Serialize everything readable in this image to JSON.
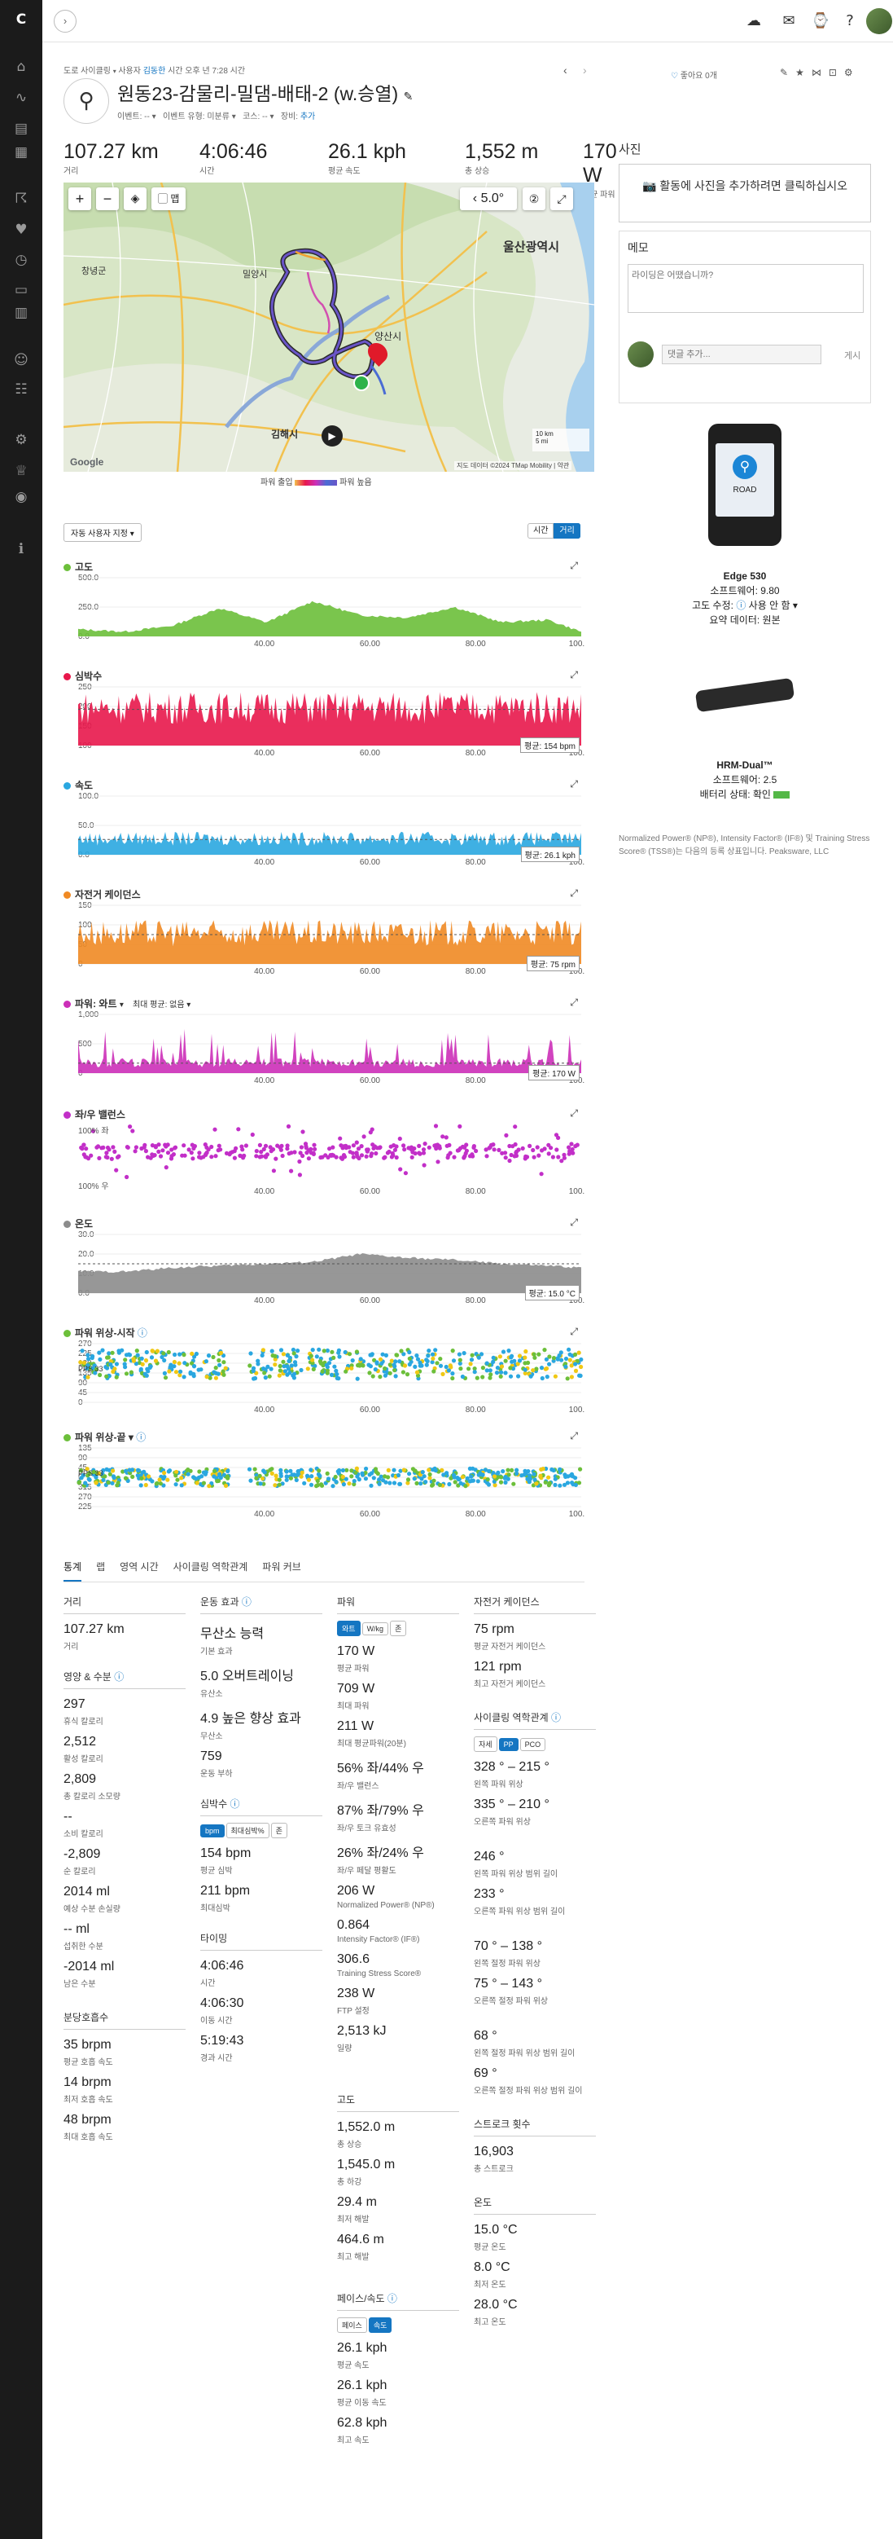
{
  "breadcrumb": {
    "category": "도로 사이클링",
    "by_prefix": "사용자",
    "user": "김동한",
    "date": "시간 오후 년 7:28 시간"
  },
  "activity": {
    "title": "원동23-감물리-밀댐-배태-2 (w.승열)",
    "like": "좋아요 0개",
    "meta": {
      "event_label": "이벤트:",
      "event_value": "--",
      "event_type_label": "이벤트 유형:",
      "event_type_value": "미분류",
      "course_label": "코스:",
      "course_value": "--",
      "gear_label": "장비:",
      "gear_value": "추가"
    }
  },
  "stats": [
    {
      "value": "107.27 km",
      "label": "거리"
    },
    {
      "value": "4:06:46",
      "label": "시간"
    },
    {
      "value": "26.1 kph",
      "label": "평균 속도"
    },
    {
      "value": "1,552 m",
      "label": "총 상승"
    },
    {
      "value": "170 W",
      "label": "평균 파워"
    }
  ],
  "map": {
    "weather": "5.0°",
    "city_ulsan": "울산광역시",
    "city_gimhae": "김해시",
    "city_yangsan": "양산시",
    "city_miryang": "밀양시",
    "city_changnyeong": "창녕군",
    "scale_km": "10 km",
    "scale_mi": "5 mi",
    "copyright": "지도 데이터 ©2024 TMap Mobility",
    "terms": "약관",
    "brand": "Google",
    "legend_left": "파워 출입",
    "legend_right": "파워 높음",
    "layers_label": "맵"
  },
  "chart_controls": {
    "zoom_select": "자동 사용자 지정",
    "toggle_time": "시간",
    "toggle_distance": "거리"
  },
  "charts": {
    "elevation": {
      "title": "고도"
    },
    "heart_rate": {
      "title": "심박수",
      "avg": "평균: 154 bpm"
    },
    "speed": {
      "title": "속도",
      "avg": "평균: 26.1 kph"
    },
    "cadence": {
      "title": "자전거 케이던스",
      "avg": "평균: 75 rpm"
    },
    "power": {
      "title": "파워: 와트",
      "max_avg": "최대 평균: 없음",
      "avg": "평균: 170 W"
    },
    "balance": {
      "title": "좌/우 밸런스",
      "label_top": "100% 좌",
      "label_bottom": "100% 우"
    },
    "temperature": {
      "title": "온도",
      "avg": "평균: 15.0 °C"
    },
    "power_phase_start": {
      "title": "파워 위상-시작",
      "pps_label": "PPS 33"
    },
    "power_phase_end": {
      "title": "파워 위상-끝",
      "pps_label": "PPS 33"
    }
  },
  "chart_data": [
    {
      "type": "area",
      "title": "고도",
      "x": [
        0,
        10,
        20,
        30,
        40,
        50,
        60,
        70,
        80,
        90,
        100,
        107
      ],
      "values": [
        60,
        40,
        90,
        240,
        120,
        300,
        180,
        160,
        250,
        120,
        140,
        40
      ],
      "ylim": [
        0,
        500
      ],
      "y_ticks": [
        "500.0",
        "250.0",
        "0.0"
      ],
      "x_ticks": [
        "40.00",
        "60.00",
        "80.00",
        "100.00"
      ]
    },
    {
      "type": "area",
      "title": "심박수",
      "ylim": [
        0,
        250
      ],
      "y_ticks": [
        "250",
        "200",
        "150",
        "100"
      ],
      "x_ticks": [
        "40.00",
        "60.00",
        "80.00",
        "100.00"
      ],
      "avg": 154
    },
    {
      "type": "area",
      "title": "속도",
      "ylim": [
        0,
        100
      ],
      "y_ticks": [
        "100.0",
        "50.0",
        "0.0"
      ],
      "x_ticks": [
        "40.00",
        "60.00",
        "80.00",
        "100.00"
      ],
      "avg": 26.1
    },
    {
      "type": "area",
      "title": "자전거 케이던스",
      "ylim": [
        0,
        150
      ],
      "y_ticks": [
        "150",
        "100",
        "50",
        "0"
      ],
      "x_ticks": [
        "40.00",
        "60.00",
        "80.00",
        "100.00"
      ],
      "avg": 75
    },
    {
      "type": "area",
      "title": "파워: 와트",
      "ylim": [
        0,
        1000
      ],
      "y_ticks": [
        "1,000",
        "500",
        "0"
      ],
      "x_ticks": [
        "40.00",
        "60.00",
        "80.00",
        "100.00"
      ],
      "avg": 170
    },
    {
      "type": "scatter",
      "title": "좌/우 밸런스",
      "ylim": [
        -100,
        100
      ],
      "x_ticks": [
        "40.00",
        "60.00",
        "80.00",
        "100.00"
      ]
    },
    {
      "type": "area",
      "title": "온도",
      "x": [
        0,
        10,
        20,
        30,
        40,
        50,
        60,
        70,
        80,
        90,
        100,
        107
      ],
      "values": [
        11,
        11,
        13,
        14,
        15,
        16,
        20,
        18,
        17,
        15,
        14,
        13
      ],
      "ylim": [
        0,
        30
      ],
      "y_ticks": [
        "30.0",
        "20.0",
        "10.0",
        "0.0"
      ],
      "x_ticks": [
        "40.00",
        "60.00",
        "80.00",
        "100.00"
      ],
      "avg": 15.0
    },
    {
      "type": "scatter",
      "title": "파워 위상-시작",
      "y_ticks": [
        "270",
        "225",
        "180",
        "135",
        "90",
        "45",
        "0"
      ],
      "x_ticks": [
        "40.00",
        "60.00",
        "80.00",
        "100.00"
      ]
    },
    {
      "type": "scatter",
      "title": "파워 위상-끝",
      "y_ticks": [
        "135",
        "90",
        "45",
        "0",
        "315",
        "270",
        "225"
      ],
      "x_ticks": [
        "40.00",
        "60.00",
        "80.00",
        "100.00"
      ]
    }
  ],
  "tabs": [
    "통계",
    "랩",
    "영역 시간",
    "사이클링 역학관계",
    "파워 커브"
  ],
  "summary": {
    "distance": {
      "head": "거리",
      "value": "107.27 km",
      "label": "거리"
    },
    "nutrition": {
      "head": "영양 & 수분",
      "items": [
        {
          "value": "297",
          "label": "휴식 칼로리"
        },
        {
          "value": "2,512",
          "label": "활성 칼로리"
        },
        {
          "value": "2,809",
          "label": "총 칼로리 소모량"
        },
        {
          "value": "--",
          "label": "소비 칼로리"
        },
        {
          "value": "-2,809",
          "label": "순 칼로리"
        },
        {
          "value": "2014 ml",
          "label": "예상 수분 손실량"
        },
        {
          "value": "-- ml",
          "label": "섭취한 수분"
        },
        {
          "value": "-2014 ml",
          "label": "남은 수분"
        }
      ]
    },
    "respiration": {
      "head": "분당호흡수",
      "items": [
        {
          "value": "35 brpm",
          "label": "평균 호흡 속도"
        },
        {
          "value": "14 brpm",
          "label": "최저 호흡 속도"
        },
        {
          "value": "48 brpm",
          "label": "최대 호흡 속도"
        }
      ]
    },
    "training": {
      "head": "운동 효과",
      "items": [
        {
          "value": "무산소 능력",
          "label": "기본 효과"
        },
        {
          "value": "5.0 오버트레이닝",
          "label": "유산소"
        },
        {
          "value": "4.9 높은 향상 효과",
          "label": "무산소"
        },
        {
          "value": "759",
          "label": "운동 부하"
        }
      ]
    },
    "heart": {
      "head": "심박수",
      "buttons": [
        "bpm",
        "최대심박%",
        "존"
      ],
      "items": [
        {
          "value": "154 bpm",
          "label": "평균 심박"
        },
        {
          "value": "211 bpm",
          "label": "최대심박"
        }
      ]
    },
    "timing": {
      "head": "타이밍",
      "items": [
        {
          "value": "4:06:46",
          "label": "시간"
        },
        {
          "value": "4:06:30",
          "label": "이동 시간"
        },
        {
          "value": "5:19:43",
          "label": "경과 시간"
        }
      ]
    },
    "power": {
      "head": "파워",
      "buttons": [
        "와트",
        "W/kg",
        "존"
      ],
      "items": [
        {
          "value": "170 W",
          "label": "평균 파워"
        },
        {
          "value": "709 W",
          "label": "최대 파워"
        },
        {
          "value": "211 W",
          "label": "최대 평균파워(20분)"
        },
        {
          "value": "56% 좌/44% 우",
          "label": "좌/우 밸런스"
        },
        {
          "value": "87% 좌/79% 우",
          "label": "좌/우 토크 유효성"
        },
        {
          "value": "26% 좌/24% 우",
          "label": "좌/우 페달 평활도"
        },
        {
          "value": "206 W",
          "label": "Normalized Power® (NP®)"
        },
        {
          "value": "0.864",
          "label": "Intensity Factor® (IF®)"
        },
        {
          "value": "306.6",
          "label": "Training Stress Score®"
        },
        {
          "value": "238 W",
          "label": "FTP 설정"
        },
        {
          "value": "2,513 kJ",
          "label": "일량"
        }
      ]
    },
    "elevation": {
      "head": "고도",
      "items": [
        {
          "value": "1,552.0 m",
          "label": "총 상승"
        },
        {
          "value": "1,545.0 m",
          "label": "총 하강"
        },
        {
          "value": "29.4 m",
          "label": "최저 해발"
        },
        {
          "value": "464.6 m",
          "label": "최고 해발"
        }
      ]
    },
    "pace": {
      "head": "페이스/속도",
      "buttons": [
        "페이스",
        "속도"
      ],
      "items": [
        {
          "value": "26.1 kph",
          "label": "평균 속도"
        },
        {
          "value": "26.1 kph",
          "label": "평균 이동 속도"
        },
        {
          "value": "62.8 kph",
          "label": "최고 속도"
        }
      ]
    },
    "cadence": {
      "head": "자전거 케이던스",
      "items": [
        {
          "value": "75 rpm",
          "label": "평균 자전거 케이던스"
        },
        {
          "value": "121 rpm",
          "label": "최고 자전거 케이던스"
        }
      ]
    },
    "dynamics": {
      "head": "사이클링 역학관계",
      "buttons": [
        "자세",
        "PP",
        "PCO"
      ],
      "items": [
        {
          "value": "328 ° – 215 °",
          "label": "왼쪽 파워 위상"
        },
        {
          "value": "335 ° – 210 °",
          "label": "오른쪽 파워 위상"
        },
        {
          "value": "246 °",
          "label": "왼쪽 파워 위상 범위 길이"
        },
        {
          "value": "233 °",
          "label": "오른쪽 파워 위상 범위 길이"
        },
        {
          "value": "70 ° – 138 °",
          "label": "왼쪽 절정 파워 위상"
        },
        {
          "value": "75 ° – 143 °",
          "label": "오른쪽 절정 파워 위상"
        },
        {
          "value": "68 °",
          "label": "왼쪽 절정 파워 위상 범위 길이"
        },
        {
          "value": "69 °",
          "label": "오른쪽 절정 파워 위상 범위 길이"
        }
      ]
    },
    "strokes": {
      "head": "스트로크 횟수",
      "items": [
        {
          "value": "16,903",
          "label": "총 스트로크"
        }
      ]
    },
    "temperature": {
      "head": "온도",
      "items": [
        {
          "value": "15.0 °C",
          "label": "평균 온도"
        },
        {
          "value": "8.0 °C",
          "label": "최저 온도"
        },
        {
          "value": "28.0 °C",
          "label": "최고 온도"
        }
      ]
    }
  },
  "right": {
    "photos_head": "사진",
    "photos_add": "활동에 사진을 추가하려면 클릭하십시오",
    "notes_head": "메모",
    "notes_placeholder": "라이딩은 어땠습니까?",
    "comment_placeholder": "댓글 추가...",
    "comment_post": "게시",
    "device": {
      "name": "Edge 530",
      "software": "소프트웨어: 9.80",
      "elev_correction": "고도 수정:",
      "elev_value": "사용 안 함",
      "data_label": "요약 데이터: 원본",
      "screen_text": "ROAD"
    },
    "sensor": {
      "name": "HRM-Dual™",
      "software": "소프트웨어: 2.5",
      "battery": "배터리 상태: 확인"
    },
    "footnote": "Normalized Power® (NP®), Intensity Factor® (IF®) 및 Training Stress Score® (TSS®)는 다음의 등록 상표입니다. Peaksware, LLC"
  },
  "colors": {
    "elevation": "#6cbf3a",
    "heart_rate": "#e8174b",
    "speed": "#2aa7e0",
    "cadence": "#f08a24",
    "power": "#cc2fb8",
    "balance": "#c22fc8",
    "temperature": "#8c8c8c",
    "accent": "#1576c2",
    "sidebar": "#1b1b1b"
  }
}
